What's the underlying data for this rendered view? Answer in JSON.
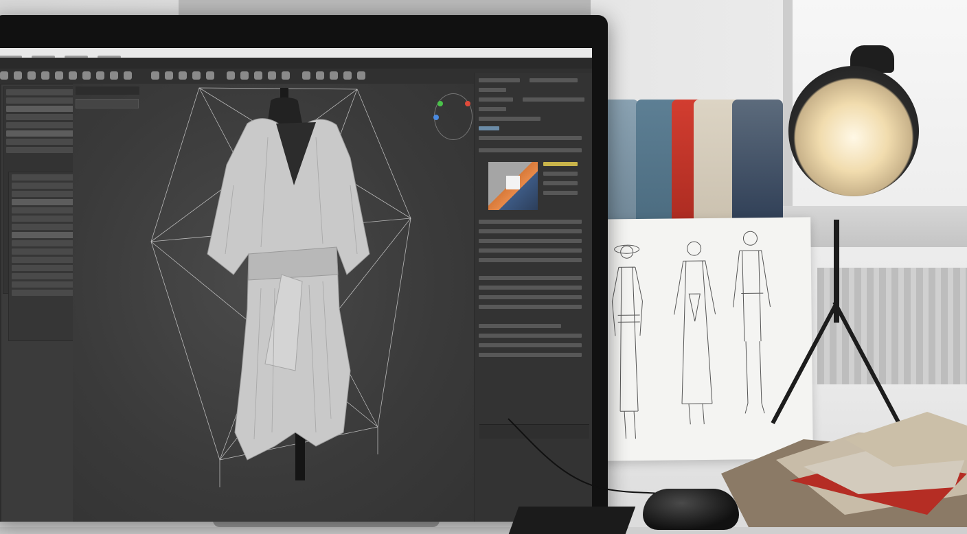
{
  "scene": "workspace",
  "colors": {
    "app_bg": "#3b3b3b",
    "panel": "#333333",
    "gizmo_x": "#e04a3a",
    "gizmo_y": "#4ac24a",
    "gizmo_z": "#4a8ae0",
    "fabric_blue": "#7c95a6",
    "fabric_red": "#c23a2e",
    "fabric_beige": "#d8cfbf",
    "fabric_navy": "#1f2f4a"
  },
  "icons": {
    "toolbar_count": 28,
    "lamp": "desk-lamp-icon",
    "mouse": "mouse-icon"
  }
}
